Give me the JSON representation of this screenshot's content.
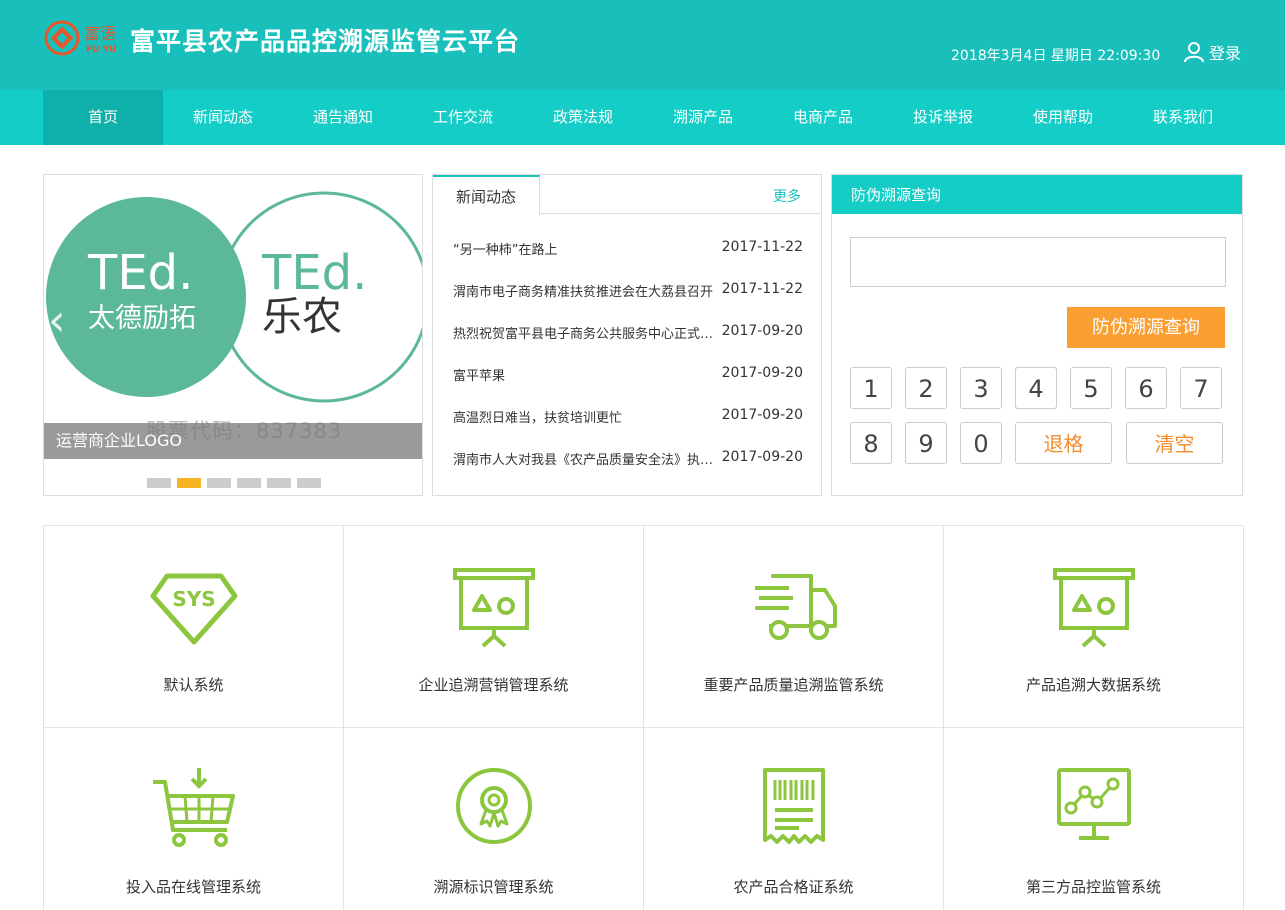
{
  "header": {
    "logo_text_cn": "富语",
    "logo_text_en": "FU YU",
    "title": "富平县农产品品控溯源监管云平台",
    "datetime": "2018年3月4日 星期日 22:09:30",
    "login_label": "登录"
  },
  "nav": {
    "items": [
      {
        "label": "首页"
      },
      {
        "label": "新闻动态"
      },
      {
        "label": "通告通知"
      },
      {
        "label": "工作交流"
      },
      {
        "label": "政策法规"
      },
      {
        "label": "溯源产品"
      },
      {
        "label": "电商产品"
      },
      {
        "label": "投诉举报"
      },
      {
        "label": "使用帮助"
      },
      {
        "label": "联系我们"
      }
    ]
  },
  "banner": {
    "brand_left_en": "TEd.",
    "brand_left_cn": "太德励拓",
    "brand_right_en": "TEd.",
    "brand_right_cn": "乐农",
    "caption": "运营商企业LOGO",
    "stock_code": "股票代码：837383",
    "active_dot": 1,
    "dot_count": 6
  },
  "news": {
    "tab_label": "新闻动态",
    "more_label": "更多",
    "items": [
      {
        "title": "“另一种柿”在路上",
        "date": "2017-11-22"
      },
      {
        "title": "渭南市电子商务精准扶贫推进会在大荔县召开",
        "date": "2017-11-22"
      },
      {
        "title": "热烈祝贺富平县电子商务公共服务中心正式运营",
        "date": "2017-09-20"
      },
      {
        "title": "富平苹果",
        "date": "2017-09-20"
      },
      {
        "title": "高温烈日难当，扶贫培训更忙",
        "date": "2017-09-20"
      },
      {
        "title": "渭南市人大对我县《农产品质量安全法》执法检查",
        "date": "2017-09-20"
      }
    ]
  },
  "query": {
    "title": "防伪溯源查询",
    "input_value": "",
    "button_label": "防伪溯源查询",
    "keys": [
      "1",
      "2",
      "3",
      "4",
      "5",
      "6",
      "7",
      "8",
      "9",
      "0"
    ],
    "backspace_label": "退格",
    "clear_label": "清空"
  },
  "systems": [
    {
      "label": "默认系统",
      "icon": "sys-diamond-icon"
    },
    {
      "label": "企业追溯营销管理系统",
      "icon": "presentation-board-icon"
    },
    {
      "label": "重要产品质量追溯监管系统",
      "icon": "delivery-truck-icon"
    },
    {
      "label": "产品追溯大数据系统",
      "icon": "presentation-board-icon"
    },
    {
      "label": "投入品在线管理系统",
      "icon": "shopping-cart-icon"
    },
    {
      "label": "溯源标识管理系统",
      "icon": "award-badge-icon"
    },
    {
      "label": "农产品合格证系统",
      "icon": "barcode-receipt-icon"
    },
    {
      "label": "第三方品控监管系统",
      "icon": "line-chart-monitor-icon"
    }
  ],
  "colors": {
    "header_bg": "#19c0bb",
    "nav_bg": "#14cdc7",
    "nav_active": "#0fafaa",
    "accent_orange": "#fa9f32",
    "icon_green": "#8cc63f",
    "logo_orange": "#e8552a"
  }
}
